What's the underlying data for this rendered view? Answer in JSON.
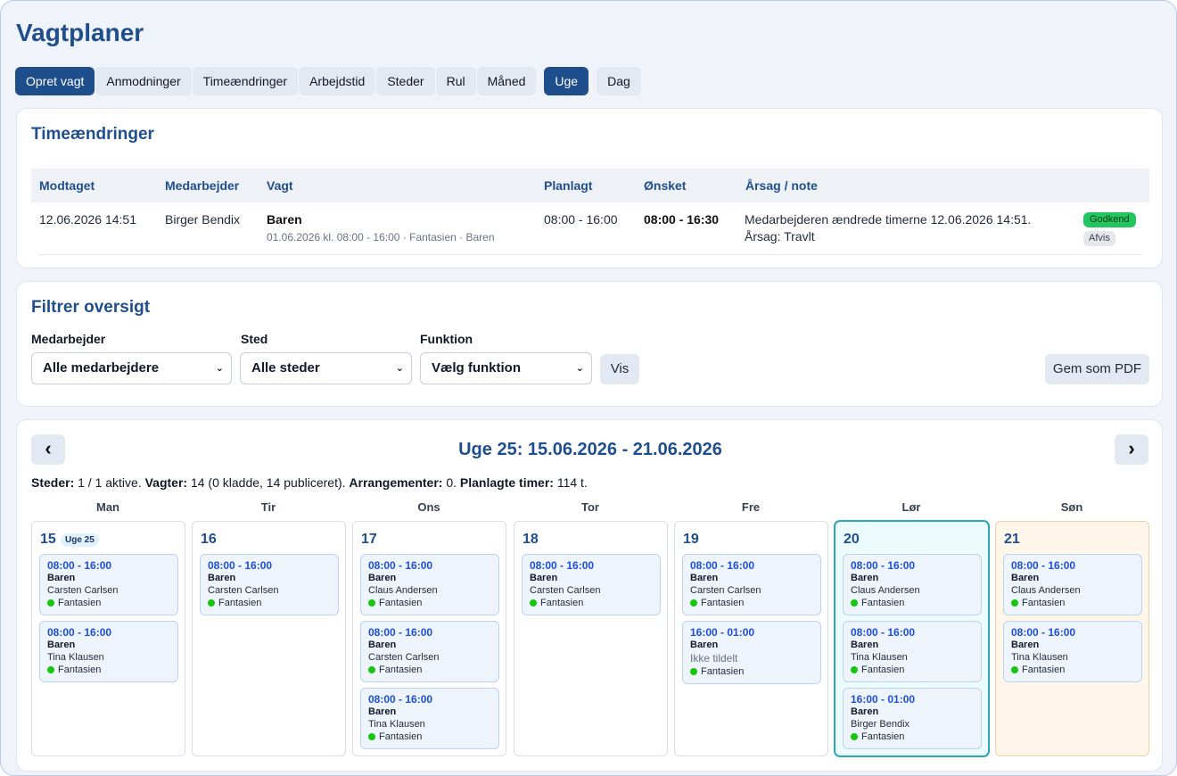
{
  "page": {
    "title": "Vagtplaner"
  },
  "tabs": {
    "create_shift": "Opret vagt",
    "requests": "Anmodninger",
    "hour_changes": "Timeændringer",
    "working_time": "Arbejdstid",
    "places": "Steder",
    "rota": "Rul",
    "month": "Måned",
    "week": "Uge",
    "day": "Dag"
  },
  "hour_changes": {
    "title": "Timeændringer",
    "columns": [
      "Modtaget",
      "Medarbejder",
      "Vagt",
      "Planlagt",
      "Ønsket",
      "Årsag / note"
    ],
    "rows": [
      {
        "received": "12.06.2026 14:51",
        "employee": "Birger Bendix",
        "shift_name": "Baren",
        "shift_detail": "01.06.2026 kl. 08:00 - 16:00 · Fantasien · Baren",
        "planned": "08:00 - 16:00",
        "wanted": "08:00 - 16:30",
        "note_line1": "Medarbejderen ændrede timerne 12.06.2026 14:51.",
        "note_line2": "Årsag: Travlt",
        "approve": "Godkend",
        "reject": "Afvis"
      }
    ]
  },
  "filter": {
    "title": "Filtrer oversigt",
    "employee_label": "Medarbejder",
    "employee_value": "Alle medarbejdere",
    "place_label": "Sted",
    "place_value": "Alle steder",
    "function_label": "Funktion",
    "function_value": "Vælg funktion",
    "show_button": "Vis",
    "pdf_button": "Gem som PDF"
  },
  "calendar": {
    "prev": "‹",
    "next": "›",
    "week_title": "Uge 25: 15.06.2026 - 21.06.2026",
    "stats": {
      "places_label": "Steder:",
      "places_value": "1 / 1 aktive.",
      "shifts_label": "Vagter:",
      "shifts_value": "14 (0 kladde, 14 publiceret).",
      "events_label": "Arrangementer:",
      "events_value": "0.",
      "hours_label": "Planlagte timer:",
      "hours_value": "114 t."
    },
    "week_badge": "Uge 25",
    "days": [
      {
        "name": "Man",
        "num": "15",
        "shifts": [
          {
            "time": "08:00 - 16:00",
            "place": "Baren",
            "employee": "Carsten Carlsen",
            "func": "Fantasien"
          },
          {
            "time": "08:00 - 16:00",
            "place": "Baren",
            "employee": "Tina Klausen",
            "func": "Fantasien"
          }
        ]
      },
      {
        "name": "Tir",
        "num": "16",
        "shifts": [
          {
            "time": "08:00 - 16:00",
            "place": "Baren",
            "employee": "Carsten Carlsen",
            "func": "Fantasien"
          }
        ]
      },
      {
        "name": "Ons",
        "num": "17",
        "shifts": [
          {
            "time": "08:00 - 16:00",
            "place": "Baren",
            "employee": "Claus Andersen",
            "func": "Fantasien"
          },
          {
            "time": "08:00 - 16:00",
            "place": "Baren",
            "employee": "Carsten Carlsen",
            "func": "Fantasien"
          },
          {
            "time": "08:00 - 16:00",
            "place": "Baren",
            "employee": "Tina Klausen",
            "func": "Fantasien"
          }
        ]
      },
      {
        "name": "Tor",
        "num": "18",
        "shifts": [
          {
            "time": "08:00 - 16:00",
            "place": "Baren",
            "employee": "Carsten Carlsen",
            "func": "Fantasien"
          }
        ]
      },
      {
        "name": "Fre",
        "num": "19",
        "shifts": [
          {
            "time": "08:00 - 16:00",
            "place": "Baren",
            "employee": "Carsten Carlsen",
            "func": "Fantasien"
          },
          {
            "time": "16:00 - 01:00",
            "place": "Baren",
            "employee": "Ikke tildelt",
            "func": "Fantasien"
          }
        ]
      },
      {
        "name": "Lør",
        "num": "20",
        "shifts": [
          {
            "time": "08:00 - 16:00",
            "place": "Baren",
            "employee": "Claus Andersen",
            "func": "Fantasien"
          },
          {
            "time": "08:00 - 16:00",
            "place": "Baren",
            "employee": "Tina Klausen",
            "func": "Fantasien"
          },
          {
            "time": "16:00 - 01:00",
            "place": "Baren",
            "employee": "Birger Bendix",
            "func": "Fantasien"
          }
        ]
      },
      {
        "name": "Søn",
        "num": "21",
        "shifts": [
          {
            "time": "08:00 - 16:00",
            "place": "Baren",
            "employee": "Claus Andersen",
            "func": "Fantasien"
          },
          {
            "time": "08:00 - 16:00",
            "place": "Baren",
            "employee": "Tina Klausen",
            "func": "Fantasien"
          }
        ]
      }
    ]
  },
  "colors": {
    "brand": "#1f4e8c",
    "approve": "#22c55e",
    "shift_time": "#1d4ed8",
    "function_dot": "#16c60c",
    "today_border": "#2aa6b8",
    "sunday_bg": "#fff6ea"
  }
}
